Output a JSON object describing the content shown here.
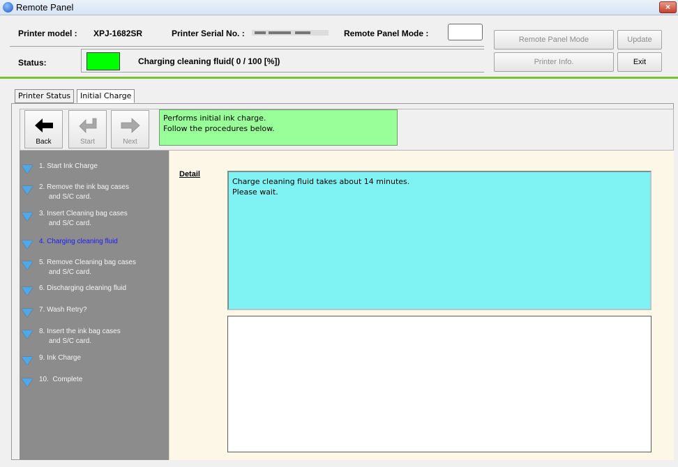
{
  "window": {
    "title": "Remote Panel",
    "close_symbol": "×"
  },
  "header": {
    "printer_model_label": "Printer model :",
    "printer_model_value": "XPJ-1682SR",
    "serial_label": "Printer Serial No. :",
    "mode_label": "Remote Panel Mode :",
    "status_label": "Status:",
    "status_text": "Charging cleaning fluid( 0 / 100 [%])",
    "status_color": "#00ff00"
  },
  "buttons": {
    "remote_panel_mode": "Remote Panel Mode",
    "update": "Update",
    "printer_info": "Printer Info.",
    "exit": "Exit"
  },
  "tabs": [
    {
      "label": "Printer Status"
    },
    {
      "label": "Initial Charge"
    }
  ],
  "nav": {
    "back": "Back",
    "start": "Start",
    "next": "Next"
  },
  "instruction": "Performs initial ink charge.\nFollow the procedures below.",
  "steps": [
    {
      "label": "1. Start Ink Charge"
    },
    {
      "label": "2. Remove the ink bag cases\n     and S/C card."
    },
    {
      "label": "3. Insert Cleaning bag cases\n     and S/C card."
    },
    {
      "label": "4. Charging cleaning fluid"
    },
    {
      "label": "5. Remove Cleaning bag cases\n     and S/C card."
    },
    {
      "label": "6. Discharging cleaning fluid"
    },
    {
      "label": "7. Wash Retry?"
    },
    {
      "label": "8. Insert the ink bag cases\n     and S/C card."
    },
    {
      "label": "9. Ink Charge"
    },
    {
      "label": "10.  Complete"
    }
  ],
  "detail": {
    "label": "Detail",
    "text": "Charge cleaning fluid takes about 14 minutes.\nPlease wait."
  }
}
